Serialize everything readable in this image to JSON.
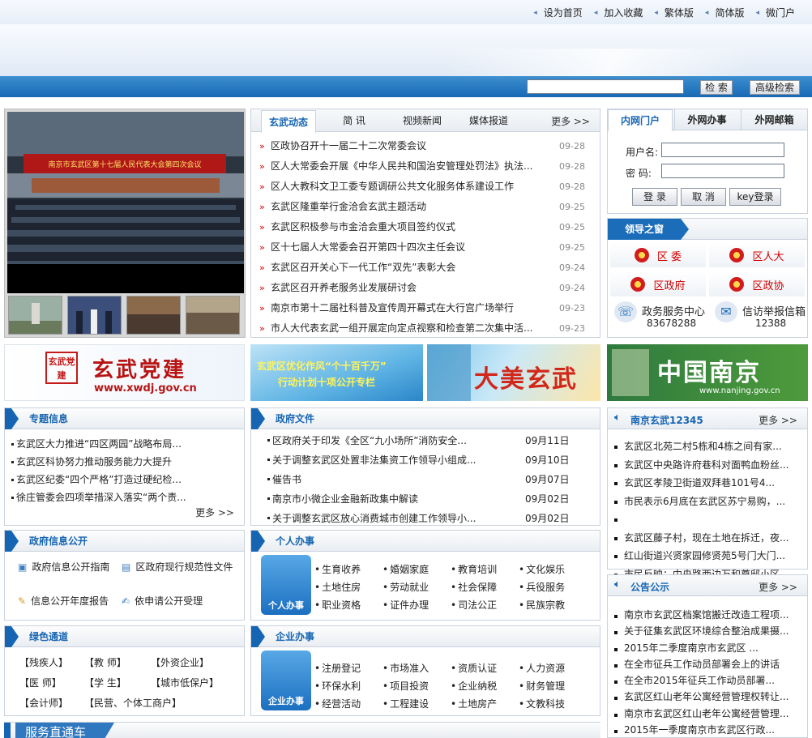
{
  "toplinks": [
    "设为首页",
    "加入收藏",
    "繁体版",
    "简体版",
    "微门户"
  ],
  "search": {
    "placeholder": "",
    "button": "检 索",
    "advanced": "高级检索"
  },
  "news": {
    "tabs": [
      "玄武动态",
      "简  讯",
      "视频新闻",
      "媒体报道"
    ],
    "more": "更多 >>",
    "items": [
      {
        "title": "区政协召开十一届二十二次常委会议",
        "date": "09-28"
      },
      {
        "title": "区人大常委会开展《中华人民共和国治安管理处罚法》执法...",
        "date": "09-28"
      },
      {
        "title": "区人大教科文卫工委专题调研公共文化服务体系建设工作",
        "date": "09-28"
      },
      {
        "title": "玄武区隆重举行金洽会玄武主题活动",
        "date": "09-25"
      },
      {
        "title": "玄武区积极参与市金洽会重大项目签约仪式",
        "date": "09-25"
      },
      {
        "title": "区十七届人大常委会召开第四十四次主任会议",
        "date": "09-25"
      },
      {
        "title": "玄武区召开关心下一代工作“双先”表彰大会",
        "date": "09-24"
      },
      {
        "title": "玄武区召开养老服务业发展研讨会",
        "date": "09-24"
      },
      {
        "title": "南京市第十二届社科普及宣传周开幕式在大行宫广场举行",
        "date": "09-23"
      },
      {
        "title": "市人大代表玄武一组开展定向定点视察和检查第二次集中活...",
        "date": "09-23"
      }
    ]
  },
  "photo": {
    "banner_text": "南京市玄武区第十七届人民代表大会第四次会议"
  },
  "login": {
    "tabs": [
      "内网门户",
      "外网办事",
      "外网邮箱"
    ],
    "username_label": "用户名:",
    "password_label": "密  码:",
    "buttons": [
      "登 录",
      "取 消",
      "key登录"
    ]
  },
  "leaders": {
    "title": "领导之窗",
    "items": [
      "区 委",
      "区人大",
      "区政府",
      "区政协"
    ],
    "contacts": [
      {
        "label": "政务服务中心",
        "phone": "83678288"
      },
      {
        "label": "信访举报信箱",
        "phone": "12388"
      }
    ]
  },
  "banners": [
    {
      "logo": "玄武党建",
      "main": "玄武党建",
      "url": "www.xwdj.gov.cn"
    },
    {
      "main": "玄武区优化作风“个十百千万”",
      "sub": "行动计划十项公开专栏"
    },
    {
      "main": "大美玄武"
    },
    {
      "main": "中国南京",
      "url": "www.nanjing.gov.cn"
    }
  ],
  "topics": {
    "title": "专题信息",
    "more": "更多 >>",
    "items": [
      "玄武区大力推进“四区两园”战略布局...",
      "玄武区科协努力推动服务能力大提升",
      "玄武区纪委“四个严格”打造过硬纪检...",
      "徐庄管委会四项举措深入落实“两个责..."
    ]
  },
  "govdocs": {
    "title": "政府文件",
    "items": [
      {
        "title": "区政府关于印发《全区“九小场所”消防安全...",
        "date": "09月11日"
      },
      {
        "title": "关于调整玄武区处置非法集资工作领导小组成...",
        "date": "09月10日"
      },
      {
        "title": "催告书",
        "date": "09月07日"
      },
      {
        "title": "南京市小微企业金融新政集中解读",
        "date": "09月02日"
      },
      {
        "title": "关于调整玄武区放心消费城市创建工作领导小...",
        "date": "09月02日"
      }
    ]
  },
  "govinfo": {
    "title": "政府信息公开",
    "items": [
      "政府信息公开指南",
      "区政府现行规范性文件",
      "信息公开年度报告",
      "依申请公开受理"
    ]
  },
  "personal": {
    "title": "个人办事",
    "icon_label": "个人办事",
    "items": [
      "生育收养",
      "婚姻家庭",
      "教育培训",
      "文化娱乐",
      "土地住房",
      "劳动就业",
      "社会保障",
      "兵役服务",
      "职业资格",
      "证件办理",
      "司法公正",
      "民族宗教"
    ]
  },
  "green": {
    "title": "绿色通道",
    "rows": [
      [
        "【残疾人】",
        "【教 师】",
        "【外资企业】"
      ],
      [
        "【医 师】",
        "【学 生】",
        "【城市低保户】"
      ],
      [
        "【会计师】",
        "【民营、个体工商户】"
      ]
    ]
  },
  "enterprise": {
    "title": "企业办事",
    "icon_label": "企业办事",
    "items": [
      "注册登记",
      "市场准入",
      "资质认证",
      "人力资源",
      "环保水利",
      "项目投资",
      "企业纳税",
      "财务管理",
      "经营活动",
      "工程建设",
      "土地房产",
      "文教科技"
    ]
  },
  "hotline": {
    "title": "南京玄武12345",
    "more": "更多 >>",
    "items": [
      "玄武区北苑二村5栋和4栋之间有家...",
      "玄武区中央路许府巷科对面鸭血粉丝...",
      "玄武区孝陵卫街道双拜巷101号4...",
      "市民表示6月底在玄武区苏宁易购，...",
      "",
      "玄武区藤子村，现在土地在拆迁，夜...",
      "红山街道兴贤家园修贤苑5号门大门...",
      "市民反映：中央路西边万和尊邸小区..."
    ]
  },
  "notice": {
    "title": "公告公示",
    "more": "更多 >>",
    "items": [
      "南京市玄武区档案馆搬迁改造工程项...",
      "关于征集玄武区环境综合整治成果摄...",
      "2015年二季度南京市玄武区 ...",
      "在全市征兵工作动员部署会上的讲话",
      "在全市2015年征兵工作动员部署...",
      "玄武区红山老年公寓经营管理权转让...",
      "南京市玄武区红山老年公寓经营管理...",
      "2015年一季度南京市玄武区行政..."
    ]
  },
  "bottom": {
    "title": "服务直通车"
  }
}
